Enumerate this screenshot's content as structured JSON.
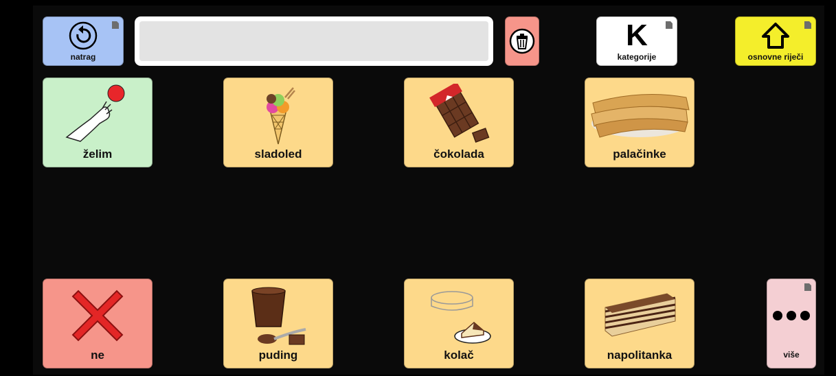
{
  "toolbar": {
    "back_label": "natrag",
    "message_text": "",
    "categories_letter": "K",
    "categories_label": "kategorije",
    "core_words_label": "osnovne riječi"
  },
  "grid": {
    "row1": [
      {
        "label": "želim",
        "color": "#c9f0c9"
      },
      {
        "label": "sladoled",
        "color": "#fdd98a"
      },
      {
        "label": "čokolada",
        "color": "#fdd98a"
      },
      {
        "label": "palačinke",
        "color": "#fdd98a"
      }
    ],
    "row2": [
      {
        "label": "ne",
        "color": "#f6958a"
      },
      {
        "label": "puding",
        "color": "#fdd98a"
      },
      {
        "label": "kolač",
        "color": "#fdd98a"
      },
      {
        "label": "napolitanka",
        "color": "#fdd98a"
      }
    ],
    "more_label": "više"
  },
  "colors": {
    "back": "#a7c3f5",
    "delete": "#f6958a",
    "categories": "#ffffff",
    "core": "#f4ee2b",
    "more": "#f4cfd3"
  }
}
